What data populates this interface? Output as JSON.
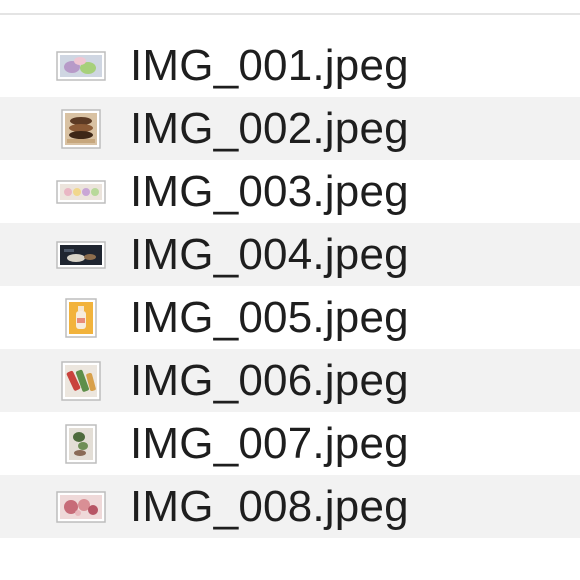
{
  "files": [
    {
      "name": "IMG_001.jpeg",
      "thumb_icon": "macaron-photo-thumbnail-icon"
    },
    {
      "name": "IMG_002.jpeg",
      "thumb_icon": "cake-stack-photo-thumbnail-icon"
    },
    {
      "name": "IMG_003.jpeg",
      "thumb_icon": "macaron-row-photo-thumbnail-icon"
    },
    {
      "name": "IMG_004.jpeg",
      "thumb_icon": "dark-food-photo-thumbnail-icon"
    },
    {
      "name": "IMG_005.jpeg",
      "thumb_icon": "bottle-photo-thumbnail-icon"
    },
    {
      "name": "IMG_006.jpeg",
      "thumb_icon": "drink-cans-photo-thumbnail-icon"
    },
    {
      "name": "IMG_007.jpeg",
      "thumb_icon": "herb-photo-thumbnail-icon"
    },
    {
      "name": "IMG_008.jpeg",
      "thumb_icon": "berry-dessert-photo-thumbnail-icon"
    }
  ],
  "colors": {
    "row_alt": "#f2f2f2",
    "divider": "#e4e4e4",
    "marker": "#f07a2e",
    "text": "#1e1e1e"
  }
}
